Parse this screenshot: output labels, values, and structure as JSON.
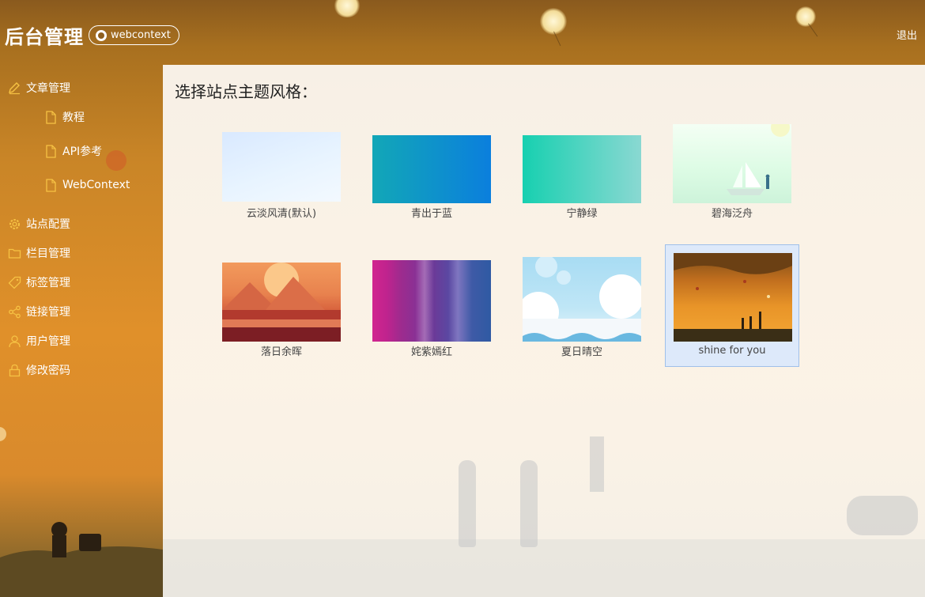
{
  "header": {
    "brand": "后台管理",
    "github_badge": "webcontext",
    "logout": "退出"
  },
  "sidebar": {
    "items": [
      {
        "label": "文章管理",
        "icon": "edit-icon"
      },
      {
        "label": "教程",
        "icon": "file-icon"
      },
      {
        "label": "API参考",
        "icon": "file-icon"
      },
      {
        "label": "WebContext",
        "icon": "file-icon"
      },
      {
        "label": "站点配置",
        "icon": "gear-icon"
      },
      {
        "label": "栏目管理",
        "icon": "folder-icon"
      },
      {
        "label": "标签管理",
        "icon": "tag-icon"
      },
      {
        "label": "链接管理",
        "icon": "share-icon"
      },
      {
        "label": "用户管理",
        "icon": "user-icon"
      },
      {
        "label": "修改密码",
        "icon": "lock-icon"
      }
    ]
  },
  "main": {
    "title": "选择站点主题风格：",
    "themes": [
      {
        "label": "云淡风清(默认)",
        "colors": [
          "#d9e9ff",
          "#f0f8ff"
        ]
      },
      {
        "label": "青出于蓝",
        "colors": [
          "#12a7b7",
          "#0b7fdd"
        ]
      },
      {
        "label": "宁静绿",
        "colors": [
          "#17d0b0",
          "#8ad8d2"
        ]
      },
      {
        "label": "碧海泛舟",
        "colors": [
          "#e6ffe8",
          "#c8f6d8"
        ]
      },
      {
        "label": "落日余晖",
        "colors": [
          "#e8824e",
          "#b42a24"
        ]
      },
      {
        "label": "姹紫嫣红",
        "colors": [
          "#d1268f",
          "#2f5aa3"
        ]
      },
      {
        "label": "夏日晴空",
        "colors": [
          "#a8dcf3",
          "#f8f8ff"
        ]
      },
      {
        "label": "shine for you",
        "colors": [
          "#c06e1e",
          "#f0a030"
        ],
        "selected": true
      }
    ]
  }
}
